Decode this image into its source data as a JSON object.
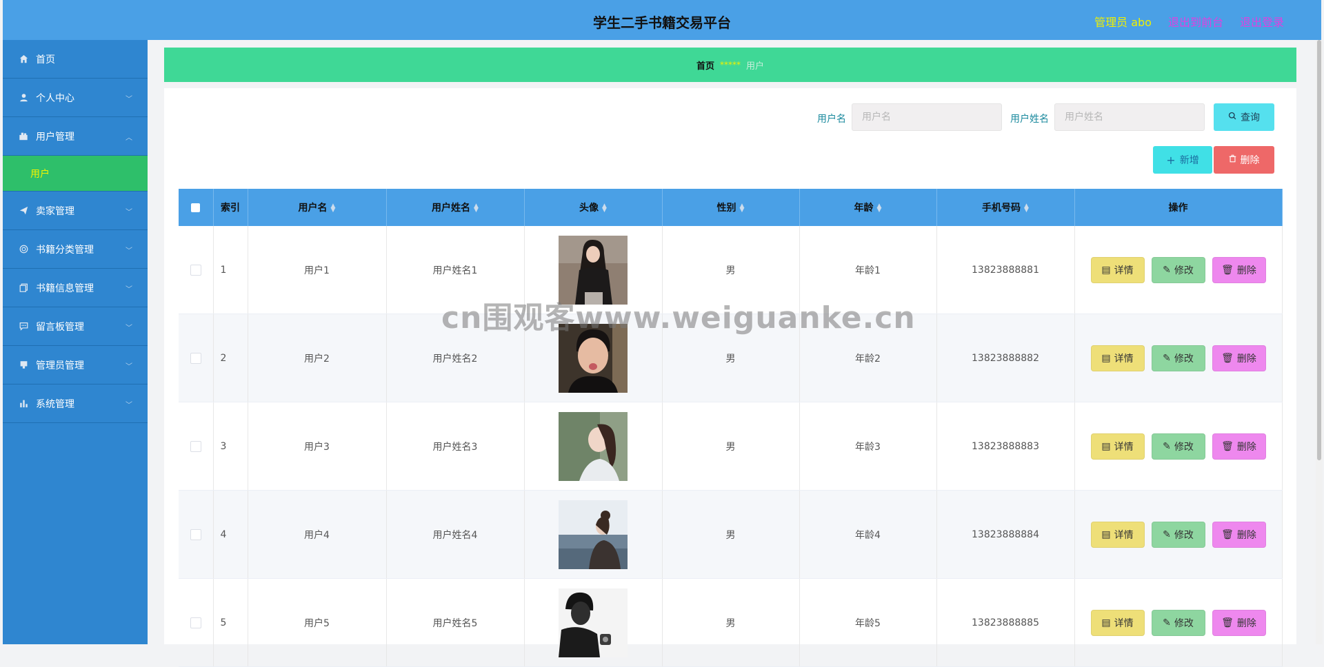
{
  "header": {
    "title": "学生二手书籍交易平台",
    "admin_label": "管理员 abo",
    "back_label": "退出到前台",
    "logout_label": "退出登录"
  },
  "sidebar": {
    "items": [
      {
        "label": "首页",
        "icon": "home-icon"
      },
      {
        "label": "个人中心",
        "icon": "user-icon"
      },
      {
        "label": "用户管理",
        "icon": "users-icon",
        "expanded": true,
        "sub": "用户"
      },
      {
        "label": "卖家管理",
        "icon": "send-icon"
      },
      {
        "label": "书籍分类管理",
        "icon": "category-icon"
      },
      {
        "label": "书籍信息管理",
        "icon": "document-icon"
      },
      {
        "label": "留言板管理",
        "icon": "message-icon"
      },
      {
        "label": "管理员管理",
        "icon": "admin-icon"
      },
      {
        "label": "系统管理",
        "icon": "chart-icon"
      }
    ]
  },
  "breadcrumb": {
    "home": "首页",
    "sep": "*****",
    "current": "用户"
  },
  "search": {
    "username_label": "用户名",
    "username_placeholder": "用户名",
    "name_label": "用户姓名",
    "name_placeholder": "用户姓名",
    "query_label": "查询"
  },
  "actions": {
    "add_label": "新增",
    "delete_label": "删除"
  },
  "table": {
    "headers": {
      "index": "索引",
      "username": "用户名",
      "name": "用户姓名",
      "avatar": "头像",
      "gender": "性别",
      "age": "年龄",
      "phone": "手机号码",
      "ops": "操作"
    },
    "op_labels": {
      "detail": "详情",
      "edit": "修改",
      "delete": "删除"
    },
    "rows": [
      {
        "index": "1",
        "username": "用户1",
        "name": "用户姓名1",
        "gender": "男",
        "age": "年龄1",
        "phone": "13823888881"
      },
      {
        "index": "2",
        "username": "用户2",
        "name": "用户姓名2",
        "gender": "男",
        "age": "年龄2",
        "phone": "13823888882"
      },
      {
        "index": "3",
        "username": "用户3",
        "name": "用户姓名3",
        "gender": "男",
        "age": "年龄3",
        "phone": "13823888883"
      },
      {
        "index": "4",
        "username": "用户4",
        "name": "用户姓名4",
        "gender": "男",
        "age": "年龄4",
        "phone": "13823888884"
      },
      {
        "index": "5",
        "username": "用户5",
        "name": "用户姓名5",
        "gender": "男",
        "age": "年龄5",
        "phone": "13823888885"
      }
    ]
  },
  "watermark": "cn围观客www.weiguanke.cn",
  "colors": {
    "header": "#4aa0e6",
    "sidebar": "#2f86d0",
    "active": "#2ebf6a",
    "breadcrumb": "#3fd896"
  }
}
